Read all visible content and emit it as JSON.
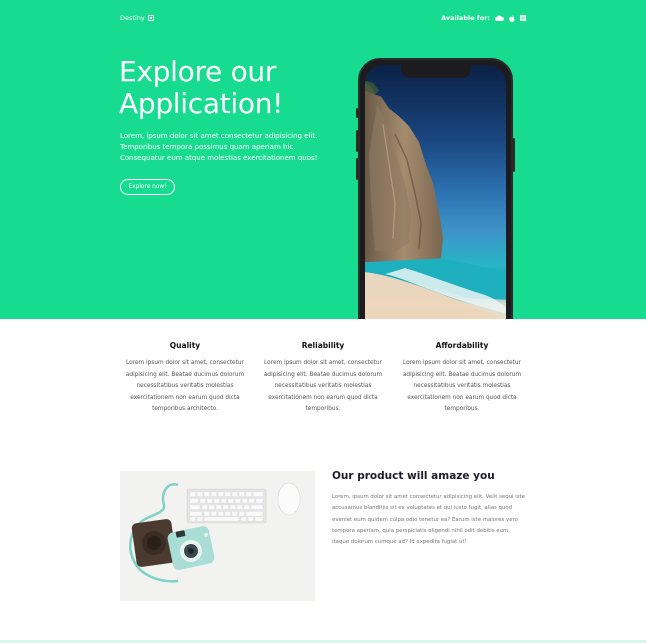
{
  "nav": {
    "brand": "Destiny",
    "available_label": "Available for:",
    "platform_icons": [
      "cloud-icon",
      "apple-icon",
      "windows-icon"
    ]
  },
  "hero": {
    "title_line1": "Explore our",
    "title_line2": "Application!",
    "description": "Lorem, ipsum dolor sit amet consectetur adipisicing elit. Temporibus tempora possimus quam aperiam hic. Consequatur eum atque molestias exercitationem quos!",
    "cta_label": "Explore now!",
    "background_color": "#17dc90"
  },
  "features": [
    {
      "title": "Quality",
      "text": "Lorem ipsum dolor sit amet, consectetur adipisicing elit. Beatae ducimus dolorum necessitatibus veritatis molestias exercitationem non earum quod dicta temporibus architecto."
    },
    {
      "title": "Reliability",
      "text": "Lorem ipsum dolor sit amet, consectetur adipisicing elit. Beatae ducimus dolorum necessitatibus veritatis molestias exercitationem non earum quod dicta temporibus."
    },
    {
      "title": "Affordability",
      "text": "Lorem ipsum dolor sit amet, consectetur adipisicing elit. Beatae ducimus dolorum necessitatibus veritatis molestias exercitationem non earum quod dicta temporibus."
    }
  ],
  "product": {
    "title": "Our product will amaze you",
    "text": "Lorem, ipsum dolor sit amet consectetur adipisicing elit. Velit sequi iste accusamus blanditiis sit ex voluptates et qui iusto fugit, alias quod eveniet eum quidem culpa odio tenetur ea? Earum iste maiores vero tempora aperiam, quia perspiciatis eligendi nihil odit debitis eum, itaque dolorum cumque ad? Id expedita fugiat ut!"
  }
}
